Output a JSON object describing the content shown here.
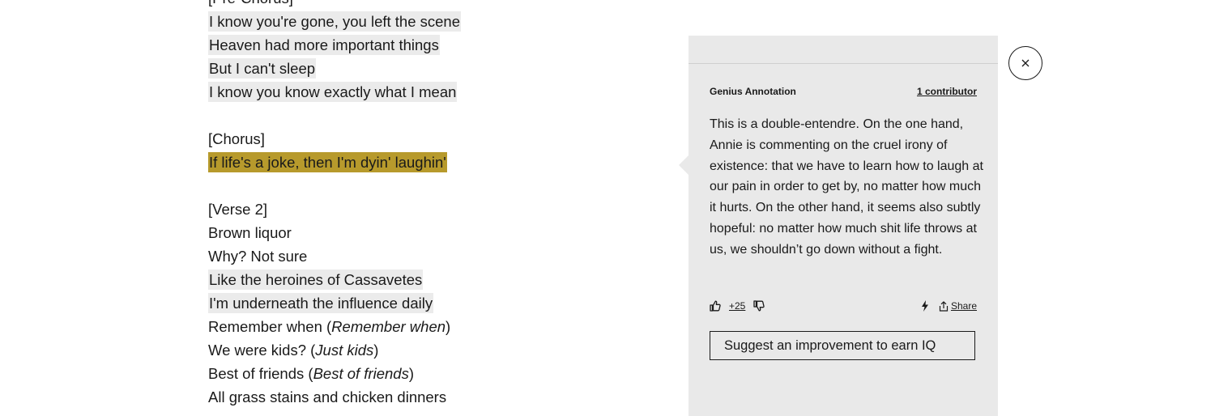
{
  "lyrics": {
    "pre_chorus_header": "[Pre-Chorus]",
    "pre_chorus": [
      "I know you're gone, you left the scene",
      "Heaven had more important things",
      "But I can't sleep",
      "I know you know exactly what I mean"
    ],
    "chorus_header": "[Chorus]",
    "chorus_line": "If life's a joke, then I'm dyin' laughin'",
    "verse2_header": "[Verse 2]",
    "verse2_plain": [
      "Brown liquor",
      "Why? Not sure"
    ],
    "verse2_highlighted": [
      "Like the heroines of Cassavetes",
      "I'm underneath the influence daily"
    ],
    "remember": {
      "text": "Remember when (",
      "echo": "Remember when",
      "close": ")"
    },
    "kids": {
      "text": "We were kids? (",
      "echo": "Just kids",
      "close": ")"
    },
    "friends": {
      "text": "Best of friends (",
      "echo": "Best of friends",
      "close": ")"
    },
    "last_line": "All grass stains and chicken dinners"
  },
  "annotation": {
    "label": "Genius Annotation",
    "contributors": "1 contributor",
    "body": "This is a double-entendre. On the one hand, Annie is commenting on the cruel irony of existence: that we have to learn how to laugh at our pain in order to get by, no matter how much it hurts. On the other hand, it seems also subtly hopeful: no matter how much shit life throws at us, we shouldn’t go down without a fight.",
    "votes": "+25",
    "share_label": "Share",
    "suggest_label": "Suggest an improvement to earn IQ"
  },
  "icons": {
    "upvote": "thumbs-up-icon",
    "downvote": "thumbs-down-icon",
    "flash": "lightning-icon",
    "share": "share-icon",
    "close": "close-icon"
  },
  "colors": {
    "active_highlight": "#b79a2c",
    "highlight": "#ebebeb",
    "panel": "#e9e9e9"
  }
}
